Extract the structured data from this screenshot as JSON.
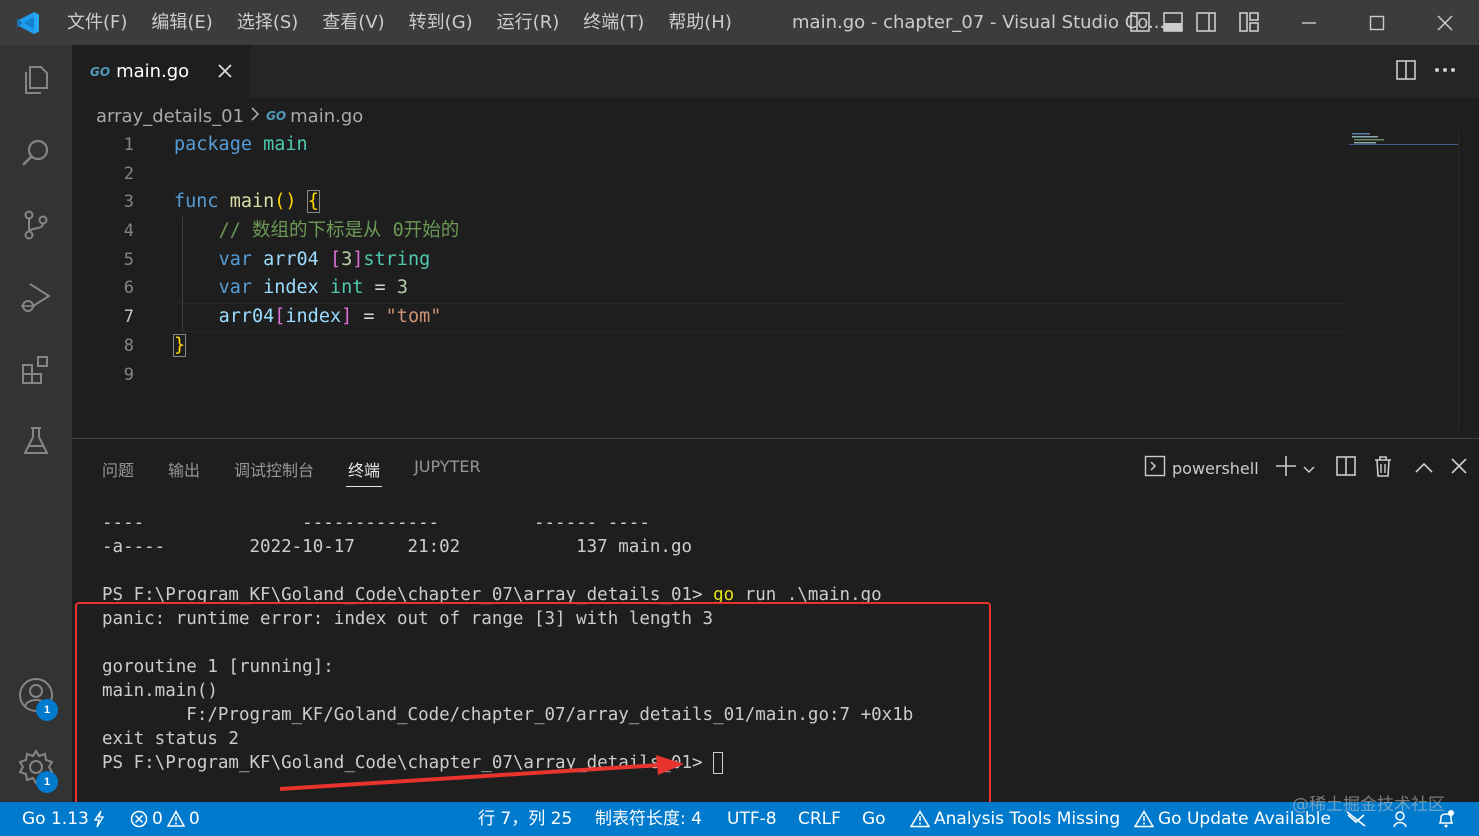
{
  "titlebar": {
    "menu": [
      "文件(F)",
      "编辑(E)",
      "选择(S)",
      "查看(V)",
      "转到(G)",
      "运行(R)",
      "终端(T)",
      "帮助(H)"
    ],
    "window_title": "main.go - chapter_07 - Visual Studio Co..."
  },
  "activity": {
    "accounts_badge": "1",
    "manage_badge": "1"
  },
  "editor": {
    "tab_icon": "GO",
    "tab_label": "main.go",
    "breadcrumb": {
      "folder": "array_details_01",
      "icon": "GO",
      "file": "main.go"
    },
    "line_numbers": [
      "1",
      "2",
      "3",
      "4",
      "5",
      "6",
      "7",
      "8",
      "9"
    ],
    "code": {
      "l1_kw": "package",
      "l1_name": "main",
      "l3_kw": "func",
      "l3_fn": "main",
      "l3_paren": "()",
      "l3_brace": "{",
      "l4_comment": "// 数组的下标是从 0开始的",
      "l5_kw": "var",
      "l5_id": "arr04",
      "l5_open": "[",
      "l5_num": "3",
      "l5_close": "]",
      "l5_type": "string",
      "l6_kw": "var",
      "l6_id": "index",
      "l6_type": "int",
      "l6_eq": "=",
      "l6_num": "3",
      "l7_id": "arr04",
      "l7_open": "[",
      "l7_idx": "index",
      "l7_close": "]",
      "l7_eq": "=",
      "l7_str": "\"tom\"",
      "l8_brace": "}"
    }
  },
  "panel": {
    "tabs": [
      "问题",
      "输出",
      "调试控制台",
      "终端",
      "JUPYTER"
    ],
    "active_tab": "终端",
    "shell": "powershell",
    "terminal": {
      "l1": "----               -------------         ------ ----",
      "l2": "-a----        2022-10-17     21:02           137 main.go",
      "l3_prompt": "PS F:\\Program_KF\\Goland_Code\\chapter_07\\array_details_01> ",
      "l3_go": "go",
      "l3_rest": " run .\\main.go",
      "l4": "panic: runtime error: index out of range [3] with length 3",
      "l5": "goroutine 1 [running]:",
      "l6": "main.main()",
      "l7": "        F:/Program_KF/Goland_Code/chapter_07/array_details_01/main.go:7 +0x1b",
      "l8": "exit status 2",
      "l9": "PS F:\\Program_KF\\Goland_Code\\chapter_07\\array_details_01> "
    }
  },
  "statusbar": {
    "go_version": "Go 1.13",
    "errors": "0",
    "warnings": "0",
    "position": "行 7，列 25",
    "tab_size": "制表符长度: 4",
    "encoding": "UTF-8",
    "eol": "CRLF",
    "language": "Go",
    "analysis": "Analysis Tools Missing",
    "update": "Go Update Available"
  },
  "watermark": "@稀土掘金技术社区",
  "colors": {
    "statusbar": "#007acc",
    "annotation_red": "#e8342c"
  }
}
